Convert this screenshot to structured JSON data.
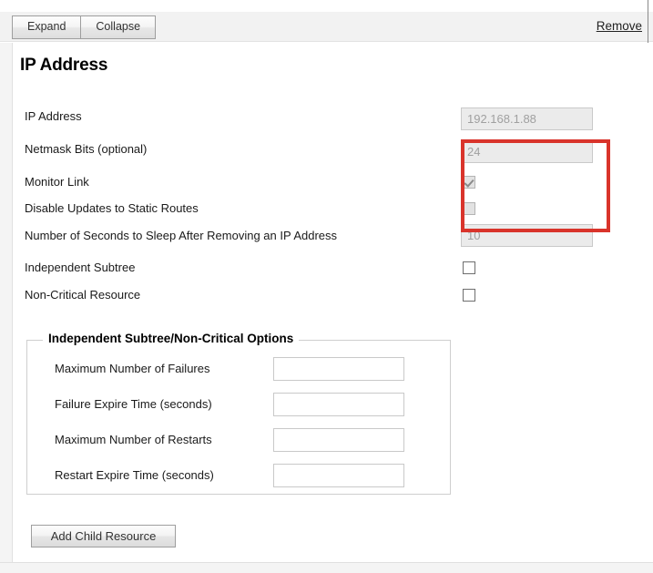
{
  "toolbar": {
    "expand_label": "Expand",
    "collapse_label": "Collapse",
    "remove_label": "Remove"
  },
  "section": {
    "title": "IP Address"
  },
  "form": {
    "rows": [
      {
        "label": "IP Address",
        "type": "text",
        "value": "192.168.1.88",
        "disabled": true
      },
      {
        "label": "Netmask Bits (optional)",
        "type": "text",
        "value": "24",
        "disabled": true
      },
      {
        "label": "Monitor Link",
        "type": "checkbox",
        "checked": true,
        "disabled": true
      },
      {
        "label": "Disable Updates to Static Routes",
        "type": "checkbox",
        "checked": false,
        "disabled": true
      },
      {
        "label": "Number of Seconds to Sleep After Removing an IP Address",
        "type": "text",
        "value": "10",
        "disabled": true
      },
      {
        "label": "Independent Subtree",
        "type": "checkbox",
        "checked": false,
        "disabled": false
      },
      {
        "label": "Non-Critical Resource",
        "type": "checkbox",
        "checked": false,
        "disabled": false
      }
    ]
  },
  "options_fieldset": {
    "legend": "Independent Subtree/Non-Critical Options",
    "rows": [
      {
        "label": "Maximum Number of Failures",
        "value": ""
      },
      {
        "label": "Failure Expire Time (seconds)",
        "value": ""
      },
      {
        "label": "Maximum Number of Restarts",
        "value": ""
      },
      {
        "label": "Restart Expire Time (seconds)",
        "value": ""
      }
    ]
  },
  "actions": {
    "add_child_label": "Add Child Resource"
  },
  "highlight": {
    "color": "#d9342b"
  }
}
